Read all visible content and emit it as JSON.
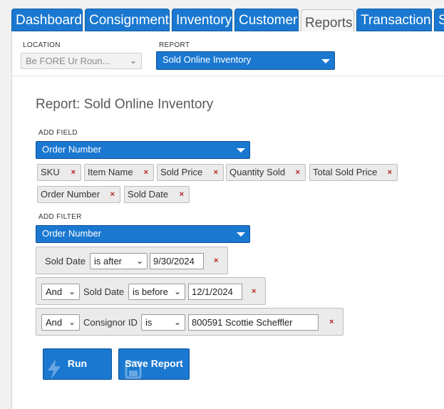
{
  "tabs": [
    {
      "label": "Dashboard",
      "active": false
    },
    {
      "label": "Consignment",
      "active": false
    },
    {
      "label": "Inventory",
      "active": false
    },
    {
      "label": "Customer",
      "active": false
    },
    {
      "label": "Reports",
      "active": true
    },
    {
      "label": "Transaction",
      "active": false
    },
    {
      "label": "S",
      "active": false
    }
  ],
  "location": {
    "label": "LOCATION",
    "value": "Be FORE Ur Roun..."
  },
  "report": {
    "label": "REPORT",
    "value": "Sold Online Inventory"
  },
  "title": "Report: Sold Online Inventory",
  "add_field": {
    "label": "ADD FIELD",
    "value": "Order Number",
    "chips": [
      "SKU",
      "Item Name",
      "Sold Price",
      "Quantity Sold",
      "Total Sold Price",
      "Order Number",
      "Sold Date"
    ]
  },
  "add_filter": {
    "label": "ADD FILTER",
    "value": "Order Number"
  },
  "filters": [
    {
      "conj": "",
      "field": "Sold Date",
      "op": "is after",
      "value": "9/30/2024"
    },
    {
      "conj": "And",
      "field": "Sold Date",
      "op": "is before",
      "value": "12/1/2024"
    },
    {
      "conj": "And",
      "field": "Consignor ID",
      "op": "is",
      "value": "800591 Scottie Scheffler"
    }
  ],
  "remove_symbol": "×",
  "buttons": {
    "run": "Run",
    "save": "Save Report"
  },
  "colors": {
    "accent": "#1a78d1",
    "remove": "#b31d1d"
  }
}
